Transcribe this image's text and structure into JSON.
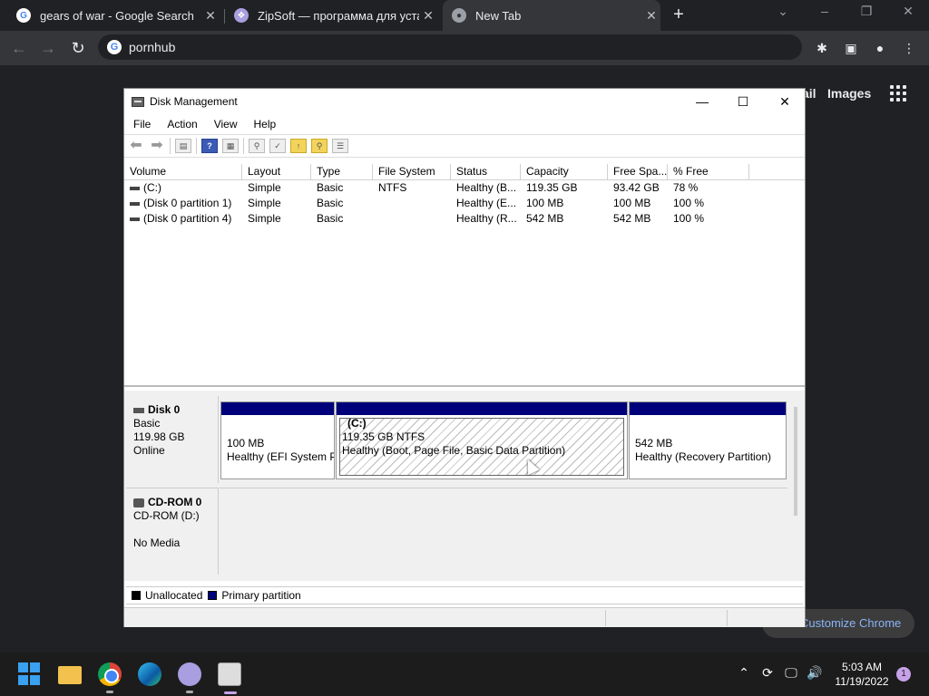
{
  "browser": {
    "tabs": [
      {
        "title": "gears of war - Google Search"
      },
      {
        "title": "ZipSoft — программа для установки"
      },
      {
        "title": "New Tab"
      }
    ],
    "address": "pornhub",
    "page_links": {
      "mail": "ail",
      "images": "Images"
    },
    "customize": "Customize Chrome"
  },
  "window": {
    "title": "Disk Management",
    "menu": [
      "File",
      "Action",
      "View",
      "Help"
    ],
    "columns": [
      "Volume",
      "Layout",
      "Type",
      "File System",
      "Status",
      "Capacity",
      "Free Spa...",
      "% Free"
    ],
    "rows": [
      [
        "(C:)",
        "Simple",
        "Basic",
        "NTFS",
        "Healthy (B...",
        "119.35 GB",
        "93.42 GB",
        "78 %"
      ],
      [
        "(Disk 0 partition 1)",
        "Simple",
        "Basic",
        "",
        "Healthy (E...",
        "100 MB",
        "100 MB",
        "100 %"
      ],
      [
        "(Disk 0 partition 4)",
        "Simple",
        "Basic",
        "",
        "Healthy (R...",
        "542 MB",
        "542 MB",
        "100 %"
      ]
    ],
    "disk0": {
      "name": "Disk 0",
      "type": "Basic",
      "size": "119.98 GB",
      "state": "Online",
      "partitions": [
        {
          "line1": "100 MB",
          "line2": "Healthy (EFI System Partition)"
        },
        {
          "name": "(C:)",
          "line1": "119.35 GB NTFS",
          "line2": "Healthy (Boot, Page File, Basic Data Partition)"
        },
        {
          "line1": "542 MB",
          "line2": "Healthy (Recovery Partition)"
        }
      ]
    },
    "cdrom": {
      "name": "CD-ROM 0",
      "type": "CD-ROM (D:)",
      "state": "No Media"
    },
    "legend": {
      "unallocated": "Unallocated",
      "primary": "Primary partition",
      "unallocated_color": "#000000",
      "primary_color": "#00007a"
    }
  },
  "taskbar": {
    "time": "5:03 AM",
    "date": "11/19/2022",
    "notifications": "1"
  }
}
